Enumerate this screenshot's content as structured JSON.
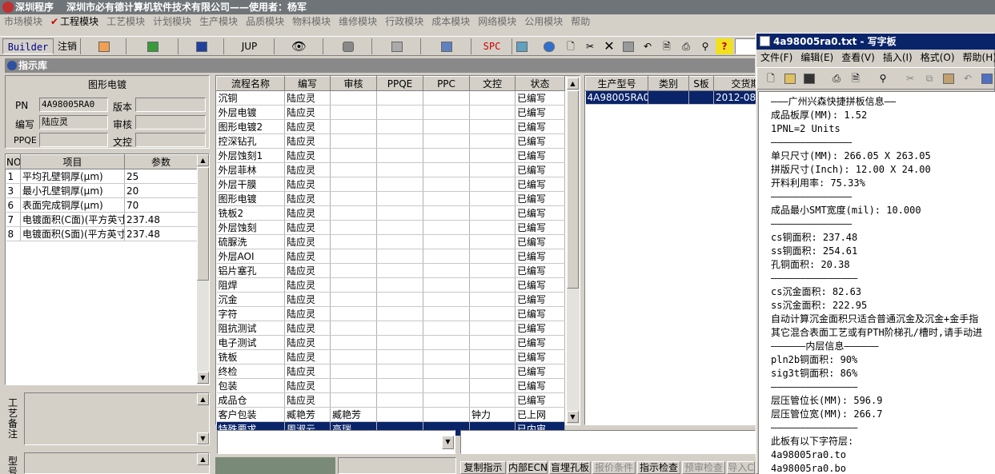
{
  "window": {
    "title": "深圳程序",
    "company": "深圳市必有德计算机软件技术有限公司——使用者：杨军"
  },
  "menu": {
    "items": [
      {
        "label": "市场模块",
        "active": false
      },
      {
        "label": "工程模块",
        "active": true
      },
      {
        "label": "工艺模块",
        "active": false
      },
      {
        "label": "计划模块",
        "active": false
      },
      {
        "label": "生产模块",
        "active": false
      },
      {
        "label": "品质模块",
        "active": false
      },
      {
        "label": "物料模块",
        "active": false
      },
      {
        "label": "维修模块",
        "active": false
      },
      {
        "label": "行政模块",
        "active": false
      },
      {
        "label": "成本模块",
        "active": false
      },
      {
        "label": "网络模块",
        "active": false
      },
      {
        "label": "公用模块",
        "active": false
      },
      {
        "label": "帮助",
        "active": false
      }
    ]
  },
  "toolbar": {
    "builder": "Builder",
    "logout": "注销",
    "jup": "JUP",
    "spc": "SPC"
  },
  "panel": {
    "title": "指示库",
    "section_title": "图形电镀",
    "pn_label": "PN",
    "pn_value": "4A98005RA0",
    "version_label": "版本",
    "version_value": "",
    "writer_label": "编写",
    "writer_value": "陆应灵",
    "review_label": "审核",
    "review_value": "",
    "ppqe_label": "PPQE",
    "ppqe_value": "",
    "doccontrol_label": "文控",
    "doccontrol_value": "",
    "remark_label": "工艺备注",
    "model_label": "型号"
  },
  "params": {
    "headers": [
      "NO",
      "项目",
      "参数"
    ],
    "rows": [
      {
        "no": "1",
        "item": "平均孔壁铜厚(μm)",
        "value": "25"
      },
      {
        "no": "3",
        "item": "最小孔壁铜厚(μm)",
        "value": "20"
      },
      {
        "no": "6",
        "item": "表面完成铜厚(μm)",
        "value": "70"
      },
      {
        "no": "7",
        "item": "电镀面积(C面)(平方英寸)",
        "value": "237.48"
      },
      {
        "no": "8",
        "item": "电镀面积(S面)(平方英寸)",
        "value": "237.48"
      }
    ]
  },
  "process": {
    "headers": [
      "流程名称",
      "编写",
      "审核",
      "PPQE",
      "PPC",
      "文控",
      "状态"
    ],
    "rows": [
      {
        "name": "沉铜",
        "writer": "陆应灵",
        "review": "",
        "ppqe": "",
        "ppc": "",
        "dc": "",
        "status": "已编写"
      },
      {
        "name": "外层电镀",
        "writer": "陆应灵",
        "review": "",
        "ppqe": "",
        "ppc": "",
        "dc": "",
        "status": "已编写"
      },
      {
        "name": "图形电镀2",
        "writer": "陆应灵",
        "review": "",
        "ppqe": "",
        "ppc": "",
        "dc": "",
        "status": "已编写"
      },
      {
        "name": "控深钻孔",
        "writer": "陆应灵",
        "review": "",
        "ppqe": "",
        "ppc": "",
        "dc": "",
        "status": "已编写"
      },
      {
        "name": "外层蚀刻1",
        "writer": "陆应灵",
        "review": "",
        "ppqe": "",
        "ppc": "",
        "dc": "",
        "status": "已编写"
      },
      {
        "name": "外层菲林",
        "writer": "陆应灵",
        "review": "",
        "ppqe": "",
        "ppc": "",
        "dc": "",
        "status": "已编写"
      },
      {
        "name": "外层干膜",
        "writer": "陆应灵",
        "review": "",
        "ppqe": "",
        "ppc": "",
        "dc": "",
        "status": "已编写"
      },
      {
        "name": "图形电镀",
        "writer": "陆应灵",
        "review": "",
        "ppqe": "",
        "ppc": "",
        "dc": "",
        "status": "已编写"
      },
      {
        "name": "铣板2",
        "writer": "陆应灵",
        "review": "",
        "ppqe": "",
        "ppc": "",
        "dc": "",
        "status": "已编写"
      },
      {
        "name": "外层蚀刻",
        "writer": "陆应灵",
        "review": "",
        "ppqe": "",
        "ppc": "",
        "dc": "",
        "status": "已编写"
      },
      {
        "name": "硫脲洗",
        "writer": "陆应灵",
        "review": "",
        "ppqe": "",
        "ppc": "",
        "dc": "",
        "status": "已编写"
      },
      {
        "name": "外层AOI",
        "writer": "陆应灵",
        "review": "",
        "ppqe": "",
        "ppc": "",
        "dc": "",
        "status": "已编写"
      },
      {
        "name": "铝片塞孔",
        "writer": "陆应灵",
        "review": "",
        "ppqe": "",
        "ppc": "",
        "dc": "",
        "status": "已编写"
      },
      {
        "name": "阻焊",
        "writer": "陆应灵",
        "review": "",
        "ppqe": "",
        "ppc": "",
        "dc": "",
        "status": "已编写"
      },
      {
        "name": "沉金",
        "writer": "陆应灵",
        "review": "",
        "ppqe": "",
        "ppc": "",
        "dc": "",
        "status": "已编写"
      },
      {
        "name": "字符",
        "writer": "陆应灵",
        "review": "",
        "ppqe": "",
        "ppc": "",
        "dc": "",
        "status": "已编写"
      },
      {
        "name": "阻抗测试",
        "writer": "陆应灵",
        "review": "",
        "ppqe": "",
        "ppc": "",
        "dc": "",
        "status": "已编写"
      },
      {
        "name": "电子测试",
        "writer": "陆应灵",
        "review": "",
        "ppqe": "",
        "ppc": "",
        "dc": "",
        "status": "已编写"
      },
      {
        "name": "铣板",
        "writer": "陆应灵",
        "review": "",
        "ppqe": "",
        "ppc": "",
        "dc": "",
        "status": "已编写"
      },
      {
        "name": "终检",
        "writer": "陆应灵",
        "review": "",
        "ppqe": "",
        "ppc": "",
        "dc": "",
        "status": "已编写"
      },
      {
        "name": "包装",
        "writer": "陆应灵",
        "review": "",
        "ppqe": "",
        "ppc": "",
        "dc": "",
        "status": "已编写"
      },
      {
        "name": "成品仓",
        "writer": "陆应灵",
        "review": "",
        "ppqe": "",
        "ppc": "",
        "dc": "",
        "status": "已编写"
      },
      {
        "name": "客户包装",
        "writer": "臧艳芳",
        "review": "臧艳芳",
        "ppqe": "",
        "ppc": "",
        "dc": "钟力",
        "status": "已上网"
      },
      {
        "name": "特殊要求",
        "writer": "周淑云",
        "review": "高瑞",
        "ppqe": "",
        "ppc": "",
        "dc": "",
        "status": "已内审"
      }
    ]
  },
  "orders": {
    "headers": [
      "生产型号",
      "类别",
      "S板",
      "交货期"
    ],
    "rows": [
      {
        "model": "4A98005RA0",
        "type": "",
        "s": "",
        "date": "2012-08-"
      }
    ]
  },
  "bottom_buttons": [
    "复制指示",
    "内部ECN",
    "盲埋孔板",
    "报价条件",
    "指示检查",
    "预审检查",
    "导入C"
  ],
  "notepad": {
    "title": "4a98005ra0.txt - 写字板",
    "menu": [
      "文件(F)",
      "编辑(E)",
      "查看(V)",
      "插入(I)",
      "格式(O)",
      "帮助(H)"
    ],
    "lines": [
      "———广州兴森快捷拼板信息——",
      "成品板厚(MM): 1.52",
      "1PNL=2 Units",
      "——————————————",
      "单只尺寸(MM): 266.05 X 263.05",
      "拼版尺寸(Inch): 12.00 X 24.00",
      "开料利用率: 75.33%",
      "——————————————",
      "成品最小SMT宽度(mil): 10.000",
      "——————————————",
      "cs铜面积: 237.48",
      "ss铜面积: 254.61",
      "孔铜面积: 20.38",
      "———————————————",
      "cs沉金面积: 82.63",
      "ss沉金面积: 222.95",
      "自动计算沉金面积只适合普通沉金及沉金+金手指",
      "其它混合表面工艺或有PTH阶梯孔/槽时,请手动进",
      "——————内层信息——————",
      "pln2b铜面积: 90%",
      "sig3t铜面积: 86%",
      "———————————————",
      "层压管位长(MM): 596.9",
      "层压管位宽(MM): 266.7",
      "———————————————",
      "此板有以下字符层:",
      "4a98005ra0.to",
      "4a98005ra0.bo"
    ]
  },
  "colors": {
    "selection": "#0a246a",
    "titlebar_inactive": "#6f7478",
    "face": "#d4d0c8"
  }
}
